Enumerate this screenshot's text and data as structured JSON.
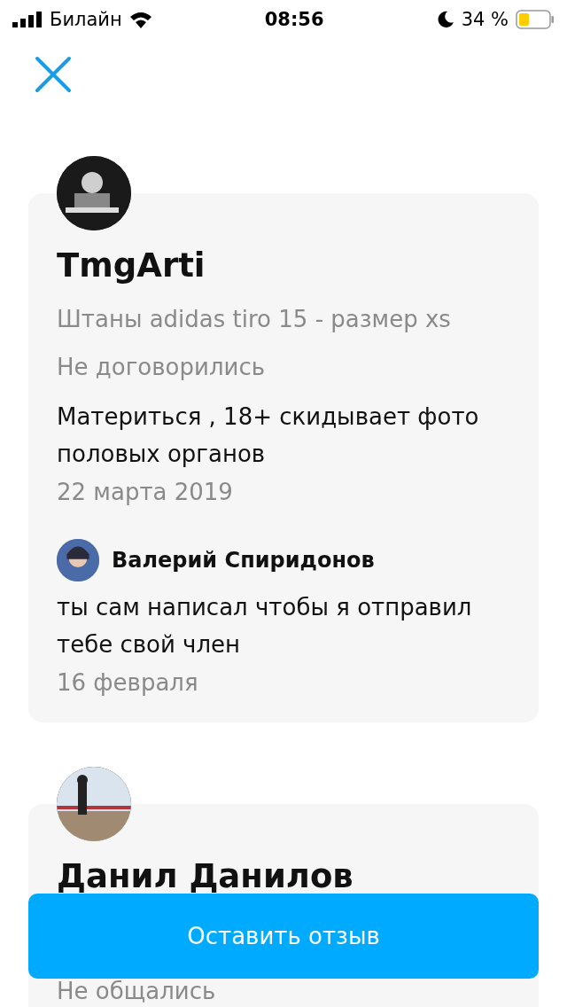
{
  "status_bar": {
    "carrier": "Билайн",
    "time": "08:56",
    "battery": "34 %"
  },
  "reviews": [
    {
      "name": "TmgArti",
      "item": "Штаны adidas tiro 15 - размер xs",
      "outcome": "Не договорились",
      "text": "Материться , 18+ скидывает фото половых органов",
      "date": "22 марта 2019",
      "reply": {
        "name": "Валерий Спиридонов",
        "text": "ты сам написал чтобы я отправил тебе свой член",
        "date": "16 февраля"
      }
    },
    {
      "name": "Данил Данилов",
      "outcome": "Не общались"
    }
  ],
  "action_button": "Оставить отзыв"
}
